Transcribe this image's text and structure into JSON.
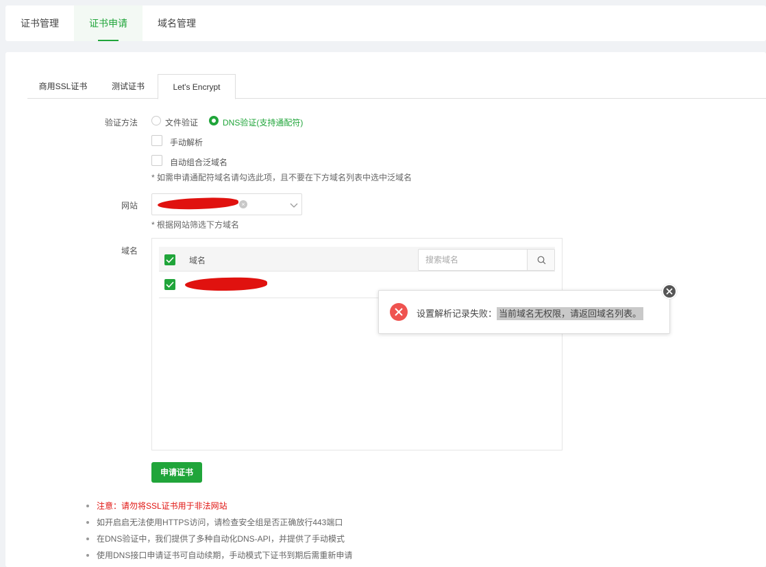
{
  "top_tabs": [
    {
      "label": "证书管理"
    },
    {
      "label": "证书申请",
      "active": true
    },
    {
      "label": "域名管理"
    }
  ],
  "sub_tabs": [
    {
      "label": "商用SSL证书"
    },
    {
      "label": "测试证书"
    },
    {
      "label": "Let's Encrypt",
      "active": true
    }
  ],
  "form": {
    "verify_label": "验证方法",
    "radio_file": "文件验证",
    "radio_dns": "DNS验证(支持通配符)",
    "selected_method": "DNS验证(支持通配符)",
    "manual_parse": "手动解析",
    "auto_wildcard": "自动组合泛域名",
    "wildcard_hint": "* 如需申请通配符域名请勾选此项，且不要在下方域名列表中选中泛域名",
    "site_label": "网站",
    "site_hint": "* 根据网站筛选下方域名",
    "domain_label": "域名",
    "domain_header": "域名",
    "search_placeholder": "搜索域名",
    "apply_button": "申请证书"
  },
  "notes": [
    "注意：请勿将SSL证书用于非法网站",
    "如开启启无法使用HTTPS访问，请检查安全组是否正确放行443端口",
    "在DNS验证中，我们提供了多种自动化DNS-API，并提供了手动模式",
    "使用DNS接口申请证书可自动续期，手动模式下证书到期后需重新申请"
  ],
  "toast": {
    "prefix": "设置解析记录失败：",
    "highlight": "当前域名无权限，请返回域名列表。"
  },
  "colors": {
    "accent": "#20a53a",
    "error": "#ef5350",
    "warning_text": "#e0120f"
  }
}
